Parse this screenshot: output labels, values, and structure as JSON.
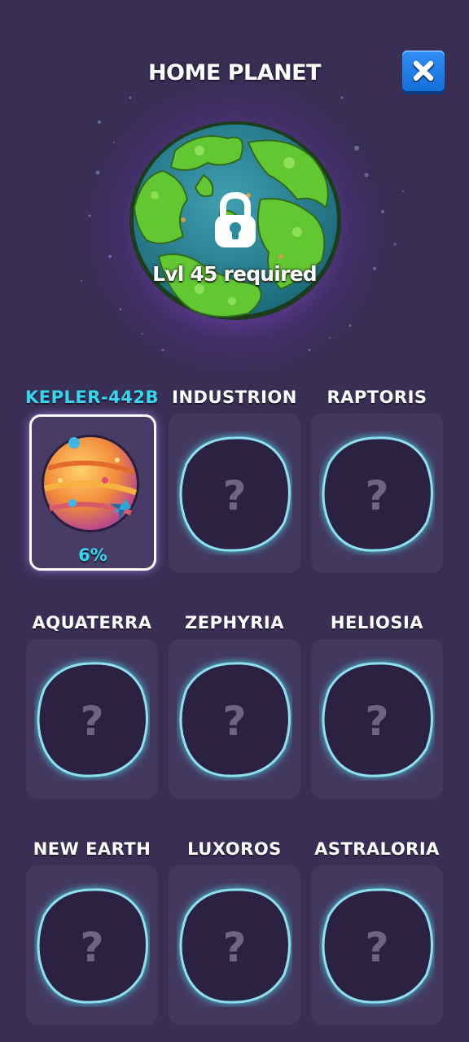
{
  "header": {
    "title": "HOME PLANET",
    "close_icon": "close-icon"
  },
  "home": {
    "requirement": "Lvl 45 required",
    "lock_icon": "lock-icon"
  },
  "planets": [
    {
      "name": "KEPLER-442B",
      "status": "6%",
      "unlocked": true
    },
    {
      "name": "INDUSTRION",
      "unknown": "?"
    },
    {
      "name": "RAPTORIS",
      "unknown": "?"
    },
    {
      "name": "AQUATERRA",
      "unknown": "?"
    },
    {
      "name": "ZEPHYRIA",
      "unknown": "?"
    },
    {
      "name": "HELIOSIA",
      "unknown": "?"
    },
    {
      "name": "NEW EARTH",
      "unknown": "?"
    },
    {
      "name": "LUXOROS",
      "unknown": "?"
    },
    {
      "name": "ASTRALORIA",
      "unknown": "?"
    }
  ],
  "colors": {
    "background": "#392e54",
    "card": "#43395f",
    "accent": "#35d6ee",
    "button": "#1f80ea"
  }
}
